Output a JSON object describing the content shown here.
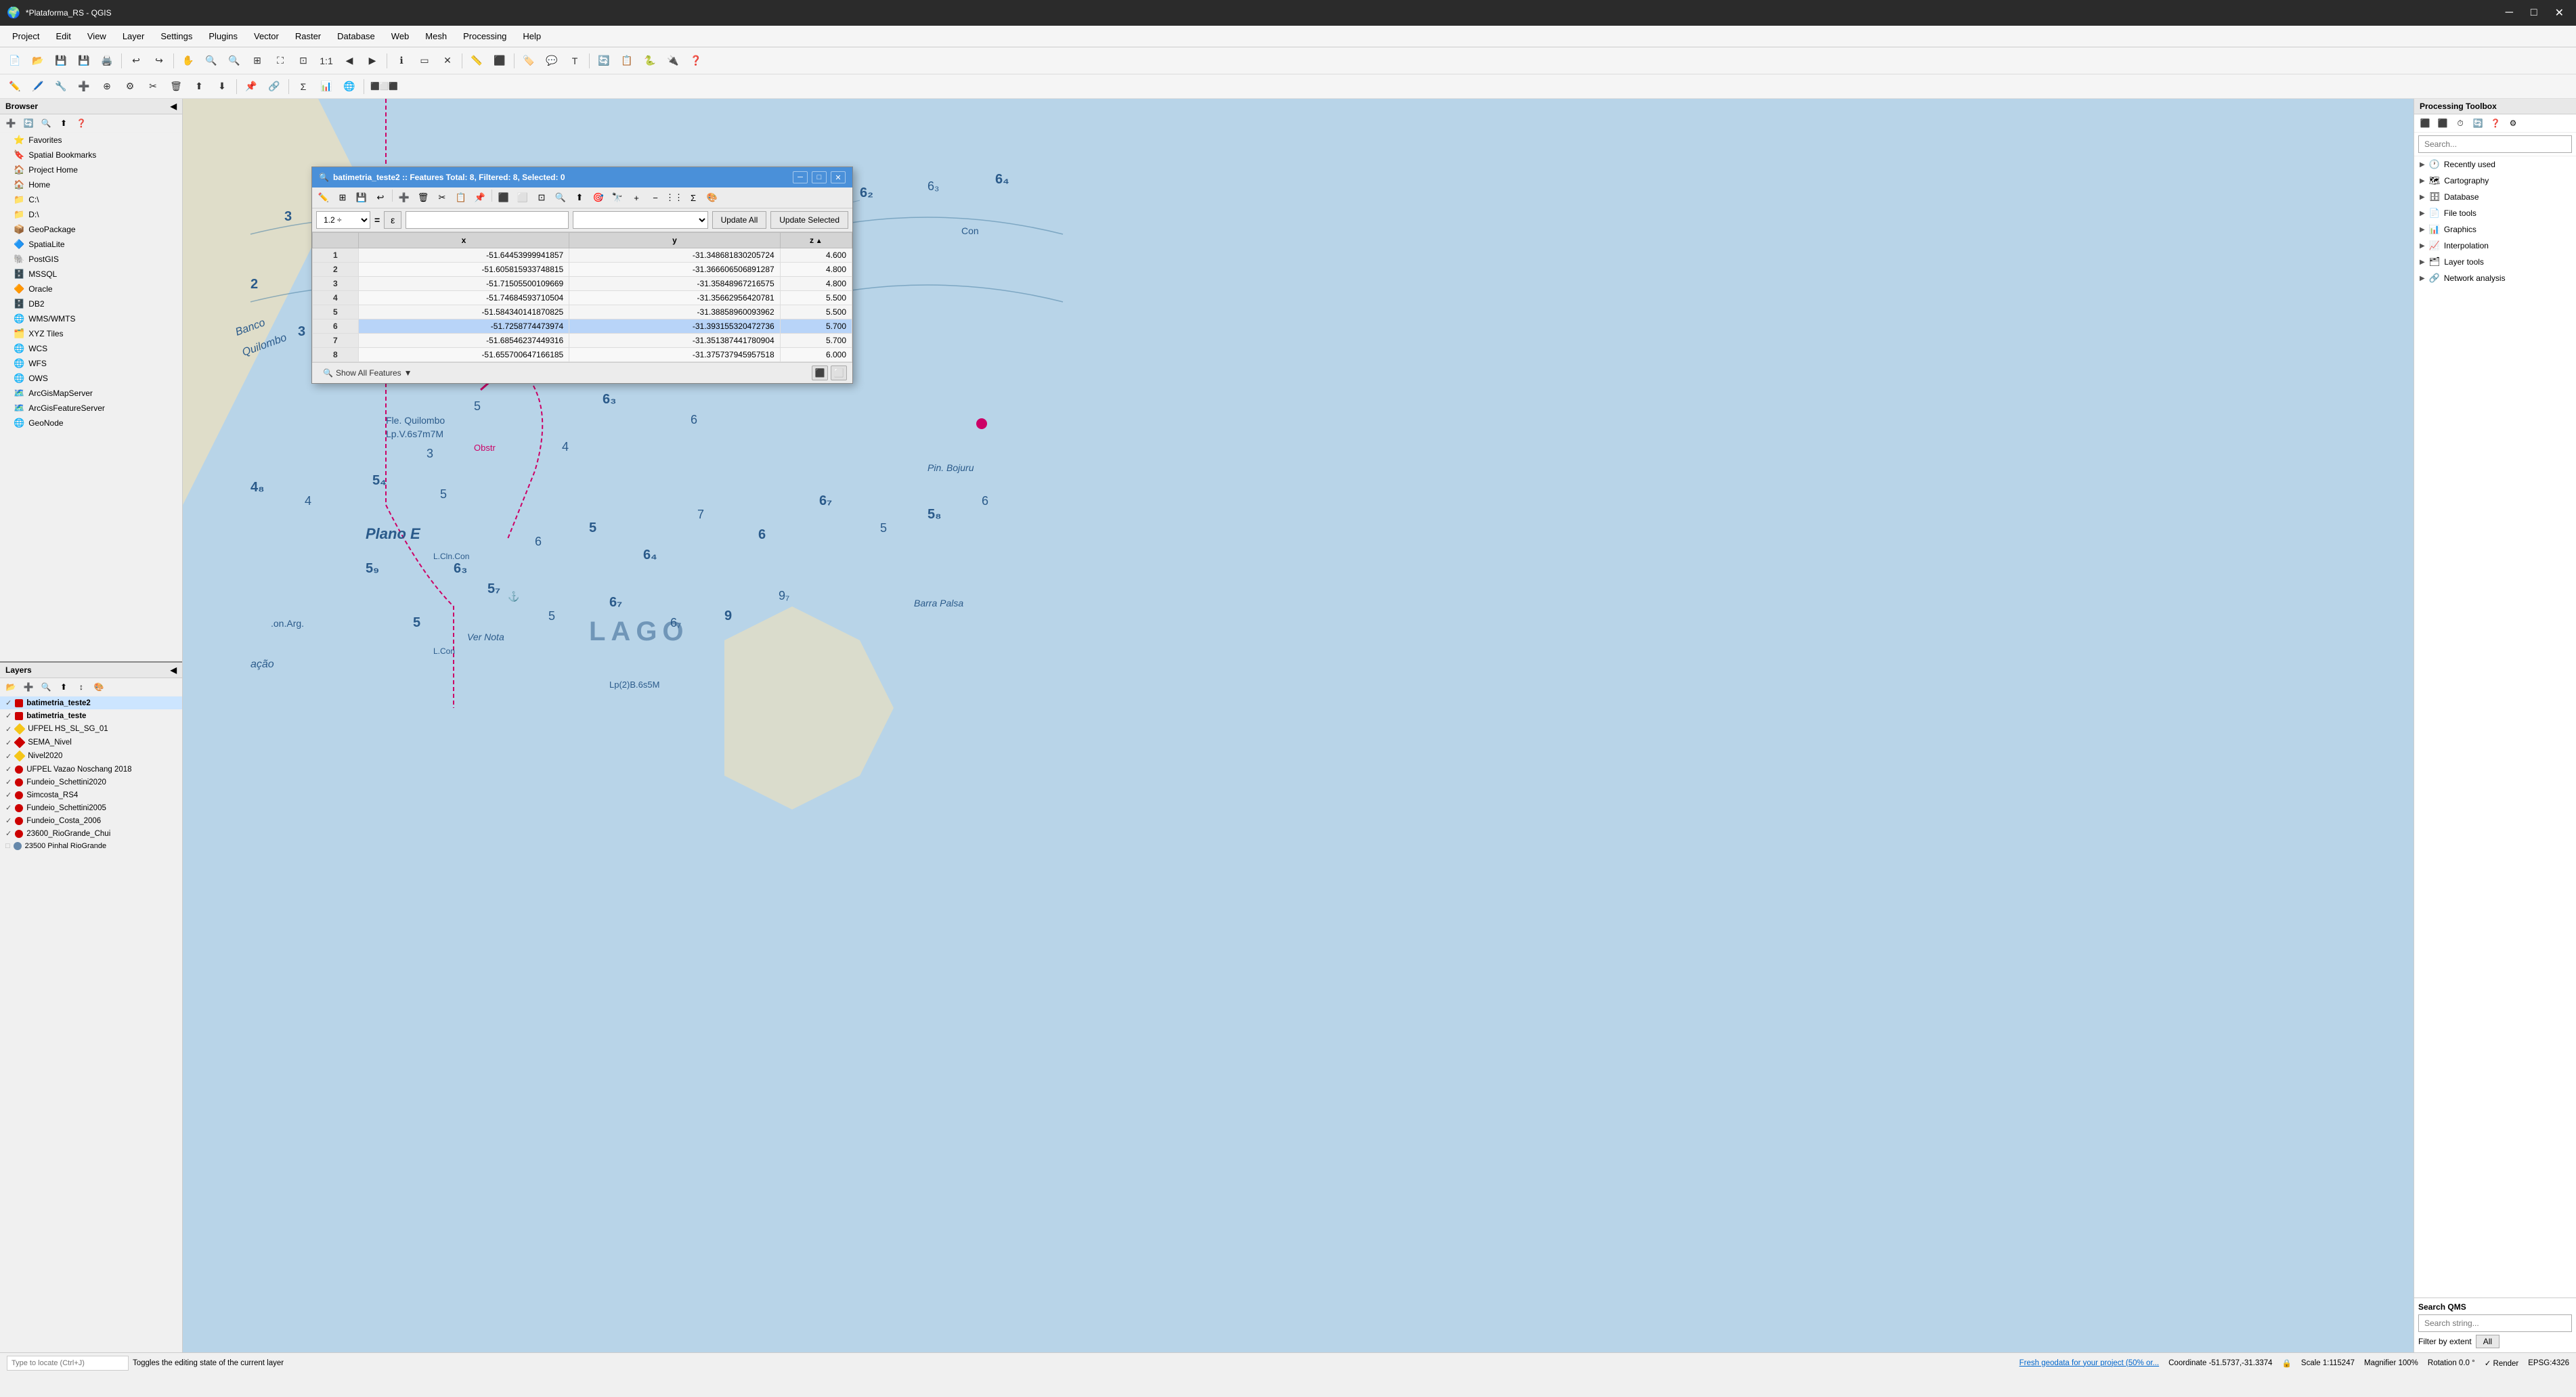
{
  "titlebar": {
    "title": "*Plataforma_RS - QGIS",
    "minimize": "─",
    "maximize": "□",
    "close": "✕"
  },
  "menu": {
    "items": [
      "Project",
      "Edit",
      "View",
      "Layer",
      "Settings",
      "Plugins",
      "Vector",
      "Raster",
      "Database",
      "Web",
      "Mesh",
      "Processing",
      "Help"
    ]
  },
  "browser": {
    "title": "Browser",
    "items": [
      {
        "icon": "⭐",
        "label": "Favorites"
      },
      {
        "icon": "🔖",
        "label": "Spatial Bookmarks"
      },
      {
        "icon": "🏠",
        "label": "Project Home"
      },
      {
        "icon": "🏠",
        "label": "Home"
      },
      {
        "icon": "📁",
        "label": "C:\\"
      },
      {
        "icon": "📁",
        "label": "D:\\"
      },
      {
        "icon": "📦",
        "label": "GeoPackage"
      },
      {
        "icon": "🔷",
        "label": "SpatiaLite"
      },
      {
        "icon": "🐘",
        "label": "PostGIS"
      },
      {
        "icon": "🗄️",
        "label": "MSSQL"
      },
      {
        "icon": "🔶",
        "label": "Oracle"
      },
      {
        "icon": "🗄️",
        "label": "DB2"
      },
      {
        "icon": "🌐",
        "label": "WMS/WMTS"
      },
      {
        "icon": "🗂️",
        "label": "XYZ Tiles"
      },
      {
        "icon": "🌐",
        "label": "WCS"
      },
      {
        "icon": "🌐",
        "label": "WFS"
      },
      {
        "icon": "🌐",
        "label": "OWS"
      },
      {
        "icon": "🗺️",
        "label": "ArcGisMapServer"
      },
      {
        "icon": "🗺️",
        "label": "ArcGisFeatureServer"
      },
      {
        "icon": "🌐",
        "label": "GeoNode"
      }
    ]
  },
  "layers": {
    "title": "Layers",
    "items": [
      {
        "check": true,
        "bold": true,
        "color": "#cc0000",
        "label": "batimetria_teste2"
      },
      {
        "check": true,
        "bold": true,
        "color": "#cc0000",
        "label": "batimetria_teste"
      },
      {
        "check": true,
        "diamond": true,
        "color": "#f5c518",
        "label": "UFPEL HS_SL_SG_01"
      },
      {
        "check": true,
        "diamond": true,
        "color": "#cc0000",
        "label": "SEMA_Nivel"
      },
      {
        "check": true,
        "diamond": true,
        "color": "#f5c518",
        "label": "Nivel2020"
      },
      {
        "check": true,
        "bold": false,
        "color": "#cc0000",
        "label": "UFPEL Vazao Noschang 2018"
      },
      {
        "check": true,
        "bold": false,
        "color": "#cc0000",
        "label": "Fundeio_Schettini2020"
      },
      {
        "check": true,
        "bold": false,
        "color": "#cc0000",
        "label": "Simcosta_RS4"
      },
      {
        "check": true,
        "bold": false,
        "color": "#cc0000",
        "label": "Fundeio_Schettini2005"
      },
      {
        "check": true,
        "bold": false,
        "color": "#cc0000",
        "label": "Fundeio_Costa_2006"
      },
      {
        "check": true,
        "bold": false,
        "color": "#cc0000",
        "label": "23600_RioGrande_Chui"
      },
      {
        "check": false,
        "bold": false,
        "color": "#6688aa",
        "label": "23500 Pinhal RioGrande"
      }
    ]
  },
  "attribute_table": {
    "title": "batimetria_teste2 :: Features Total: 8, Filtered: 8, Selected: 0",
    "columns": [
      "x",
      "y",
      "z"
    ],
    "rows": [
      {
        "id": 1,
        "x": "-51.64453999941857",
        "y": "-31.348681830205724",
        "z": "4.600"
      },
      {
        "id": 2,
        "x": "-51.6058159337488 15",
        "y": "-31.366606506891287",
        "z": "4.800"
      },
      {
        "id": 3,
        "x": "-51.71505500109669",
        "y": "-31.35848967216575",
        "z": "4.800"
      },
      {
        "id": 4,
        "x": "-51.74684593710504",
        "y": "-31.35662956420781",
        "z": "5.500"
      },
      {
        "id": 5,
        "x": "-51.584340141870825",
        "y": "-31.38858960093962",
        "z": "5.500"
      },
      {
        "id": 6,
        "x": "-51.7258774473974",
        "y": "-31.393155320472736",
        "z": "5.700",
        "selected": true
      },
      {
        "id": 7,
        "x": "-51.685462374493 16",
        "y": "-31.351387441780904",
        "z": "5.700"
      },
      {
        "id": 8,
        "x": "-51.655700647166185",
        "y": "-31.3757379459575 18",
        "z": "6.000"
      }
    ],
    "update_all": "Update All",
    "update_selected": "Update Selected",
    "show_all_features": "Show All Features",
    "field_select": "1.2 ÷",
    "eq_sign": "="
  },
  "processing_toolbox": {
    "title": "Processing Toolbox",
    "search_placeholder": "Search...",
    "items": [
      {
        "label": "Recently used",
        "icon": "▶"
      },
      {
        "label": "Cartography",
        "icon": "▶"
      },
      {
        "label": "Database",
        "icon": "▶"
      },
      {
        "label": "File tools",
        "icon": "▶"
      },
      {
        "label": "Graphics",
        "icon": "▶"
      },
      {
        "label": "Interpolation",
        "icon": "▶"
      },
      {
        "label": "Layer tools",
        "icon": "▶"
      },
      {
        "label": "Network analysis",
        "icon": "▶"
      }
    ]
  },
  "search_qms": {
    "title": "Search QMS",
    "search_placeholder": "Search string...",
    "filter_by_extent": "Filter by extent",
    "all_btn": "All"
  },
  "statusbar": {
    "locate_placeholder": "Type to locate (Ctrl+J)",
    "toggles_msg": "Toggles the editing state of the current layer",
    "coordinate": "Coordinate -51.5737,-31.3374",
    "scale": "Scale 1:115247",
    "lock_icon": "🔒",
    "magnifier": "Magnifier 100%",
    "rotation": "Rotation 0.0 °",
    "render_label": "✓ Render",
    "epsg": "EPSG:4326",
    "fresh_geodata": "Fresh geodata for your project (50% or..."
  }
}
